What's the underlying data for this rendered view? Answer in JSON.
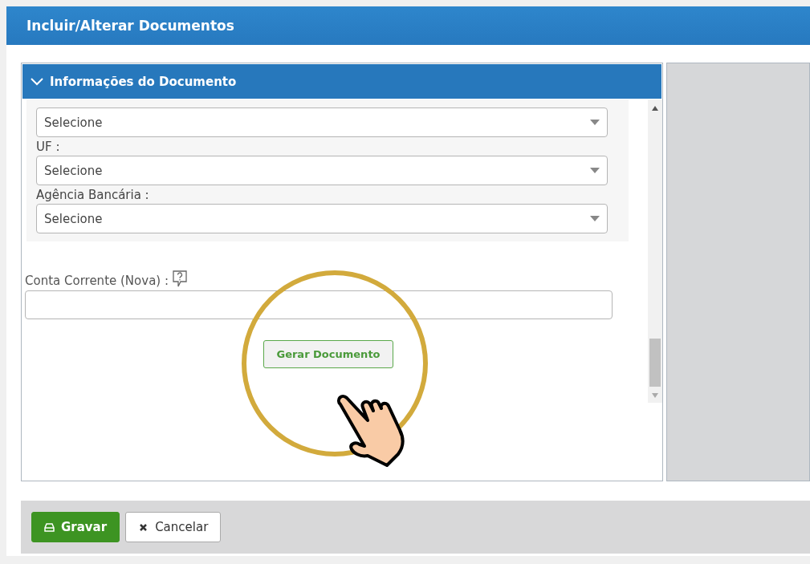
{
  "window": {
    "title": "Incluir/Alterar Documentos"
  },
  "section": {
    "title": "Informações do Documento",
    "expanded": true,
    "selects": [
      {
        "value": "Selecione"
      },
      {
        "label": "UF :",
        "value": "Selecione"
      },
      {
        "label": "Agência Bancária :",
        "value": "Selecione"
      }
    ],
    "account_field": {
      "label": "Conta Corrente (Nova) :"
    },
    "generate_button": "Gerar Documento"
  },
  "footer_buttons": [
    {
      "kind": "save",
      "label": "Gravar"
    },
    {
      "kind": "cancel",
      "label": "Cancelar"
    }
  ]
}
